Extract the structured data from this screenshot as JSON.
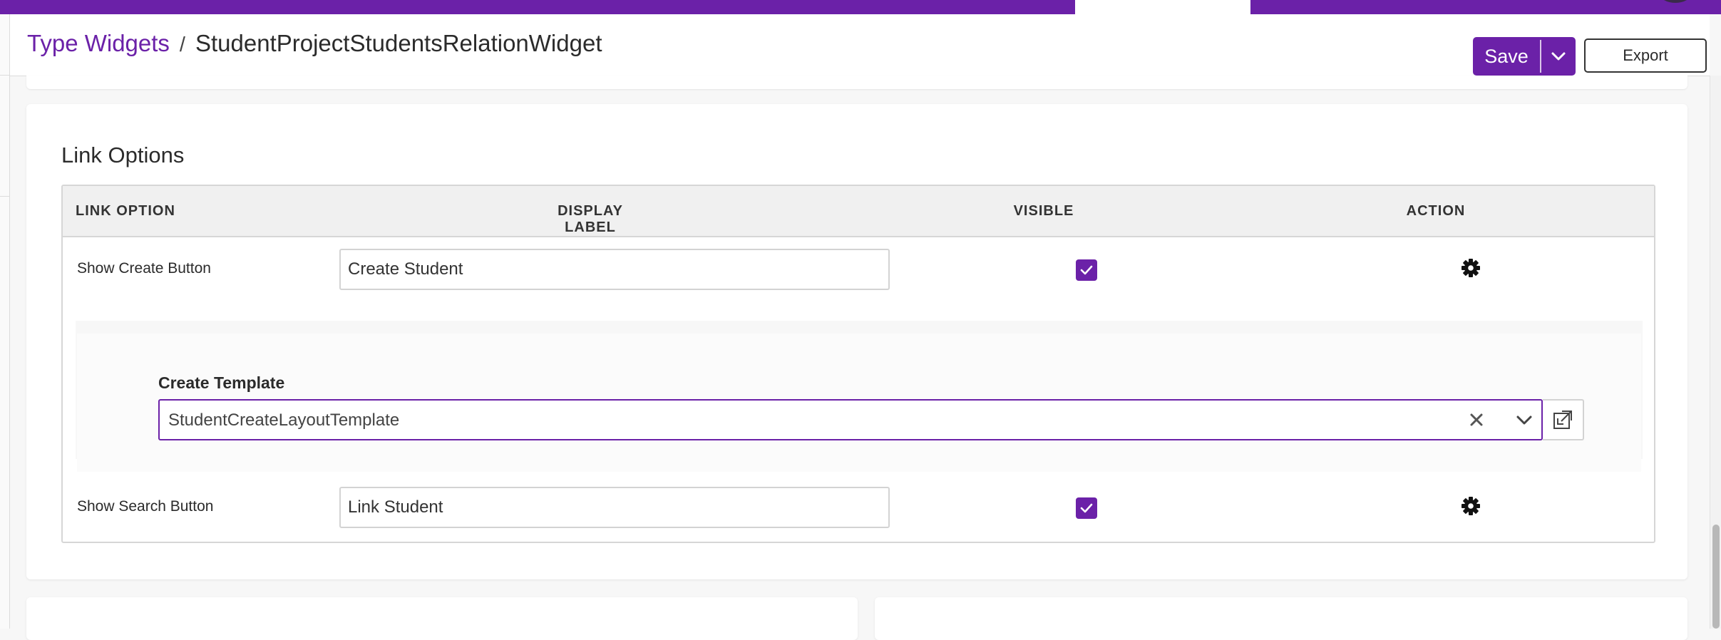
{
  "colors": {
    "brand": "#6b21a8",
    "header_bg": "#ffffff",
    "page_bg": "#f7f7f7",
    "table_header_bg": "#f0f0f0"
  },
  "breadcrumb": {
    "parent": "Type Widgets",
    "separator": "/",
    "current": "StudentProjectStudentsRelationWidget"
  },
  "toolbar": {
    "save_label": "Save",
    "export_label": "Export"
  },
  "link_options": {
    "title": "Link Options",
    "columns": [
      "LINK OPTION",
      "DISPLAY LABEL",
      "VISIBLE",
      "ACTION"
    ],
    "rows": [
      {
        "option": "Show Create Button",
        "display_label": "Create Student",
        "visible": true,
        "action_icon": "gear-icon"
      },
      {
        "option": "Show Search Button",
        "display_label": "Link Student",
        "visible": true,
        "action_icon": "gear-icon"
      }
    ],
    "create_template": {
      "label": "Create Template",
      "value": "StudentCreateLayoutTemplate"
    }
  }
}
